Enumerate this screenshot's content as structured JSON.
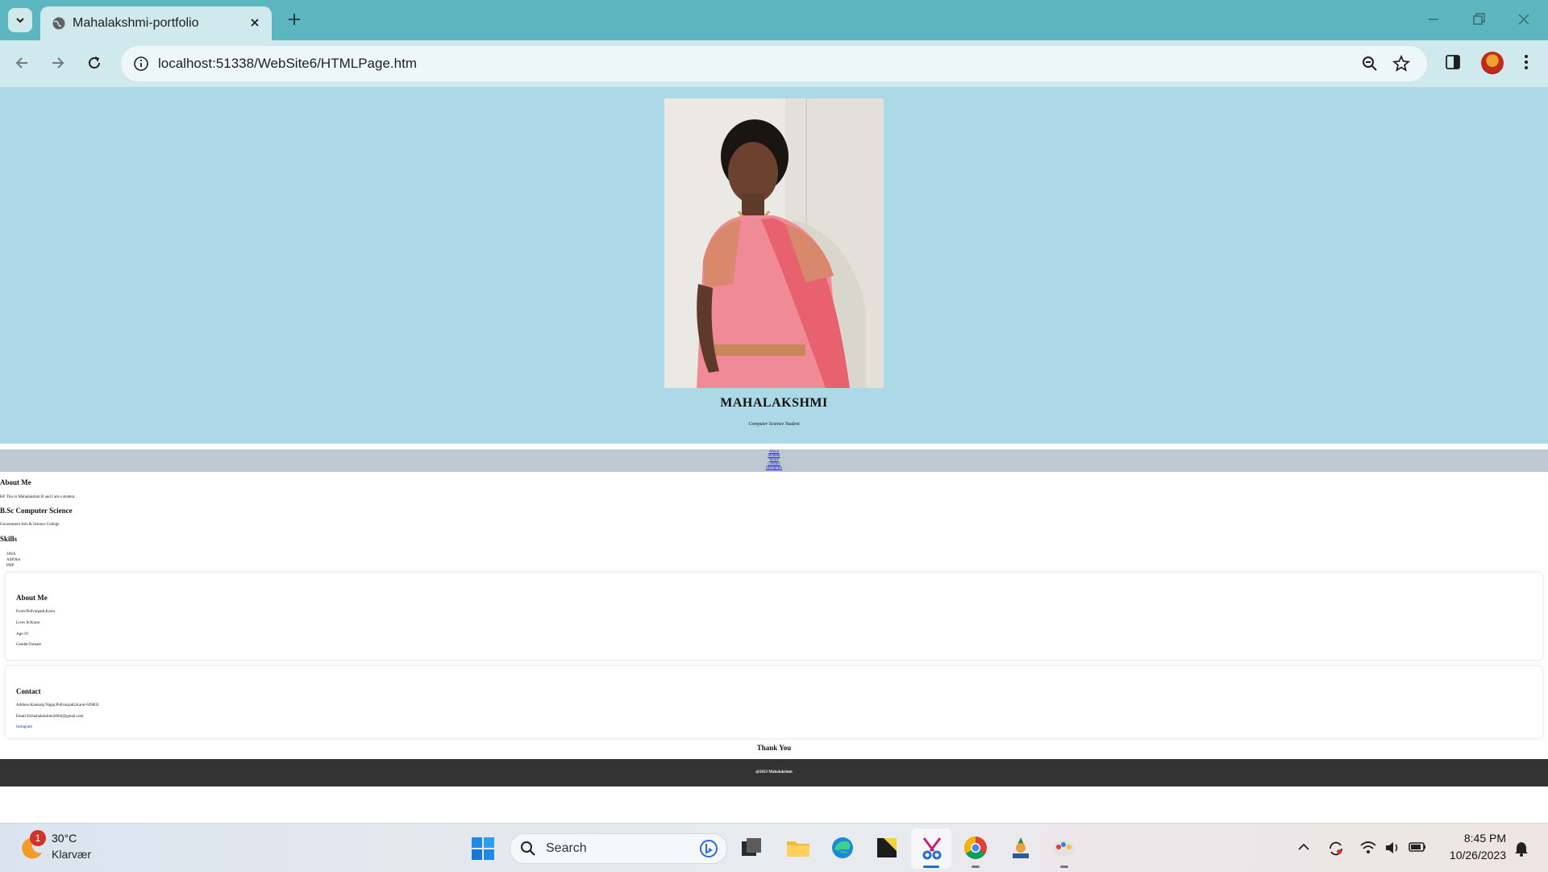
{
  "browser": {
    "tab_title": "Mahalakshmi-portfolio",
    "url": "localhost:51338/WebSite6/HTMLPage.htm"
  },
  "page": {
    "hero": {
      "name": "MAHALAKSHMI",
      "subtitle": "Computer Science Student"
    },
    "nav_links": [
      "About",
      "Student",
      "Skills",
      "Contact",
      "Instagram"
    ],
    "about": {
      "heading": "About Me",
      "text": "Hi! This is Mahalakshmi R and I am a student."
    },
    "education": {
      "heading": "B.Sc Computer Science",
      "text": "Government Arts & Science College"
    },
    "skills": {
      "heading": "Skills",
      "items": [
        "JAVA",
        "ASP.Net",
        "PHP"
      ]
    },
    "about_card": {
      "heading": "About Me",
      "lines": [
        "From:Pullvarpatti,Karur",
        "Lives In:Karur",
        "Age:19",
        "Gender:Female"
      ]
    },
    "contact_card": {
      "heading": "Contact",
      "address": "Address:Kamaraj Nagar,Pullvarpatti,Karur-639003.",
      "email": "Email-Id:mahalakshmi2004r@gmail.com",
      "link": "Instagram"
    },
    "thanks": "Thank You",
    "footer": "@2023 Mahalakshmi"
  },
  "taskbar": {
    "weather_badge": "1",
    "temperature": "30°C",
    "condition": "Klarvær",
    "search_placeholder": "Search",
    "time": "8:45 PM",
    "date": "10/26/2023"
  },
  "colors": {
    "hero_bg": "#add8e6",
    "nav_bg": "#bfc8d0",
    "footer_bg": "#333333",
    "chrome_frame": "#5bb6bf",
    "chrome_toolbar": "#cfe9ec"
  }
}
